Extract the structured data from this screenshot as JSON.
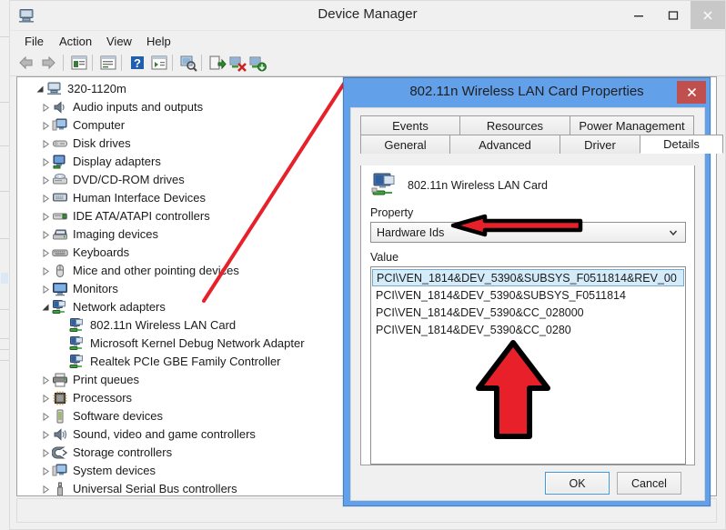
{
  "window": {
    "title": "Device Manager",
    "icon": "device-manager-icon",
    "minimize_label": "–",
    "maximize_label": "☐",
    "close_label": "✕",
    "menu": [
      "File",
      "Action",
      "View",
      "Help"
    ],
    "status_text": ""
  },
  "toolbar": {
    "items": [
      "back-icon",
      "forward-icon",
      "properties-icon",
      "help-icon",
      "question-icon",
      "show-hidden-icon",
      "scan-hardware-icon",
      "update-driver-icon",
      "disable-device-icon",
      "uninstall-device-icon"
    ]
  },
  "tree": {
    "root": {
      "label": "320-1120m",
      "icon": "computer-icon",
      "expanded": true
    },
    "items": [
      {
        "label": "Audio inputs and outputs",
        "icon": "speaker-icon",
        "depth": 1,
        "expandable": true,
        "expanded": false
      },
      {
        "label": "Computer",
        "icon": "computer-monitor-icon",
        "depth": 1,
        "expandable": true,
        "expanded": false
      },
      {
        "label": "Disk drives",
        "icon": "disk-drive-icon",
        "depth": 1,
        "expandable": true,
        "expanded": false
      },
      {
        "label": "Display adapters",
        "icon": "display-adapter-icon",
        "depth": 1,
        "expandable": true,
        "expanded": false
      },
      {
        "label": "DVD/CD-ROM drives",
        "icon": "dvd-drive-icon",
        "depth": 1,
        "expandable": true,
        "expanded": false
      },
      {
        "label": "Human Interface Devices",
        "icon": "hid-icon",
        "depth": 1,
        "expandable": true,
        "expanded": false
      },
      {
        "label": "IDE ATA/ATAPI controllers",
        "icon": "ide-controller-icon",
        "depth": 1,
        "expandable": true,
        "expanded": false
      },
      {
        "label": "Imaging devices",
        "icon": "imaging-device-icon",
        "depth": 1,
        "expandable": true,
        "expanded": false
      },
      {
        "label": "Keyboards",
        "icon": "keyboard-icon",
        "depth": 1,
        "expandable": true,
        "expanded": false
      },
      {
        "label": "Mice and other pointing devices",
        "icon": "mouse-icon",
        "depth": 1,
        "expandable": true,
        "expanded": false
      },
      {
        "label": "Monitors",
        "icon": "monitor-icon",
        "depth": 1,
        "expandable": true,
        "expanded": false
      },
      {
        "label": "Network adapters",
        "icon": "network-adapter-icon",
        "depth": 1,
        "expandable": true,
        "expanded": true
      },
      {
        "label": "802.11n Wireless LAN Card",
        "icon": "network-adapter-icon",
        "depth": 2,
        "expandable": false,
        "expanded": false
      },
      {
        "label": "Microsoft Kernel Debug Network Adapter",
        "icon": "network-adapter-icon",
        "depth": 2,
        "expandable": false,
        "expanded": false
      },
      {
        "label": "Realtek PCIe GBE Family Controller",
        "icon": "network-adapter-icon",
        "depth": 2,
        "expandable": false,
        "expanded": false
      },
      {
        "label": "Print queues",
        "icon": "printer-icon",
        "depth": 1,
        "expandable": true,
        "expanded": false
      },
      {
        "label": "Processors",
        "icon": "processor-icon",
        "depth": 1,
        "expandable": true,
        "expanded": false
      },
      {
        "label": "Software devices",
        "icon": "software-device-icon",
        "depth": 1,
        "expandable": true,
        "expanded": false
      },
      {
        "label": "Sound, video and game controllers",
        "icon": "sound-controller-icon",
        "depth": 1,
        "expandable": true,
        "expanded": false
      },
      {
        "label": "Storage controllers",
        "icon": "storage-controller-icon",
        "depth": 1,
        "expandable": true,
        "expanded": false
      },
      {
        "label": "System devices",
        "icon": "system-device-icon",
        "depth": 1,
        "expandable": true,
        "expanded": false
      },
      {
        "label": "Universal Serial Bus controllers",
        "icon": "usb-controller-icon",
        "depth": 1,
        "expandable": true,
        "expanded": false
      }
    ]
  },
  "dialog": {
    "title": "802.11n Wireless LAN Card Properties",
    "close_label": "✕",
    "tabs_row1": [
      "Events",
      "Resources",
      "Power Management"
    ],
    "tabs_row2": [
      "General",
      "Advanced",
      "Driver",
      "Details"
    ],
    "active_tab": "Details",
    "device_name": "802.11n Wireless LAN Card",
    "device_icon": "network-device-icon",
    "property_label": "Property",
    "property_selected": "Hardware Ids",
    "value_label": "Value",
    "values": [
      "PCI\\VEN_1814&DEV_5390&SUBSYS_F0511814&REV_00",
      "PCI\\VEN_1814&DEV_5390&SUBSYS_F0511814",
      "PCI\\VEN_1814&DEV_5390&CC_028000",
      "PCI\\VEN_1814&DEV_5390&CC_0280"
    ],
    "selected_value_index": 0,
    "ok_label": "OK",
    "cancel_label": "Cancel"
  },
  "annotations": {
    "line_color": "#e8202a",
    "arrow_fill": "#e8202a",
    "arrow_stroke": "#000000",
    "items": [
      "diagonal-line-to-wireless-card",
      "horizontal-arrow-to-property-dropdown",
      "up-arrow-to-value-list"
    ]
  },
  "colors": {
    "dialog_titlebar": "#62a0ea",
    "dialog_close": "#c0504d",
    "selection": "#d4ebf9",
    "window_bg": "#f0f0f0"
  }
}
